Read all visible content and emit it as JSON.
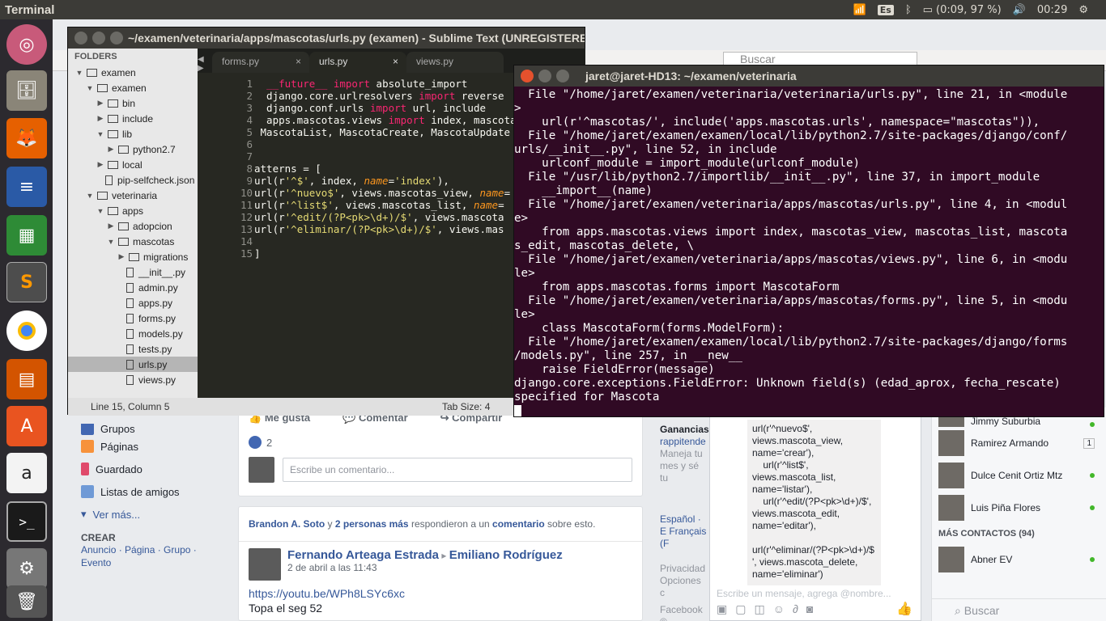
{
  "topbar": {
    "app_name": "Terminal",
    "keyboard": "Es",
    "battery": "(0:09, 97 %)",
    "clock": "00:29"
  },
  "launcher": {
    "items": [
      "dash-home",
      "files",
      "firefox",
      "libreoffice-writer",
      "libreoffice-calc",
      "sublime-text",
      "chrome",
      "libreoffice-impress",
      "software-center",
      "amazon",
      "terminal",
      "system-settings",
      "trash"
    ]
  },
  "browser": {
    "search_placeholder": "Buscar"
  },
  "fb": {
    "leftnav": [
      "Grupos",
      "Páginas",
      "Guardado",
      "Listas de amigos"
    ],
    "see_more": "Ver más...",
    "create_heading": "CREAR",
    "create_links": "Anuncio · Página · Grupo · Evento",
    "actions": [
      "Me gusta",
      "Comentar",
      "Compartir"
    ],
    "like_count": "2",
    "comment_placeholder": "Escribe un comentario...",
    "notice_user": "Brandon A. Soto",
    "notice_mid": " y ",
    "notice_others": "2 personas más",
    "notice_rest": " respondieron a un ",
    "notice_link": "comentario",
    "notice_end": " sobre esto.",
    "post_author": "Fernando Arteaga Estrada",
    "post_target": "Emiliano Rodríguez",
    "post_date": "2 de abril a las 11:43",
    "post_link": "https://youtu.be/WPh8LSYc6xc",
    "post_text": "Topa el seg 52",
    "ad_title": "Ganancias",
    "ad_site": "rappitende",
    "ad_text": "Maneja tu mes y sé tu",
    "languages": "Español · E Français (F",
    "footer1": "Privacidad Opciones c",
    "footer2": "Facebook ©"
  },
  "chat": {
    "message": "url(r'^nuevo$',\nviews.mascota_view,\nname='crear'),\n    url(r'^list$',\nviews.mascota_list,\nname='listar'),\n    url(r'^edit/(?P<pk>\\d+)/$',\nviews.mascota_edit,\nname='editar'),\n\nurl(r'^eliminar/(?P<pk>\\d+)/$\n', views.mascota_delete,\nname='eliminar')",
    "input_placeholder": "Escribe un mensaje, agrega @nombre..."
  },
  "contacts": {
    "top_partial": "Jimmy Suburbia",
    "items": [
      "Ramirez Armando",
      "Dulce Cenit Ortiz Mtz",
      "Luis Piña Flores"
    ],
    "badge": "1",
    "more_heading": "MÁS CONTACTOS (94)",
    "more_items": [
      "Abner EV"
    ],
    "search_placeholder": "Buscar"
  },
  "sublime": {
    "title": "~/examen/veterinaria/apps/mascotas/urls.py (examen) - Sublime Text (UNREGISTERED)",
    "folders_label": "FOLDERS",
    "tree": [
      {
        "label": "examen",
        "type": "folder",
        "indent": 0,
        "open": true
      },
      {
        "label": "examen",
        "type": "folder",
        "indent": 1,
        "open": true
      },
      {
        "label": "bin",
        "type": "folder",
        "indent": 2,
        "open": false
      },
      {
        "label": "include",
        "type": "folder",
        "indent": 2,
        "open": false
      },
      {
        "label": "lib",
        "type": "folder",
        "indent": 2,
        "open": true
      },
      {
        "label": "python2.7",
        "type": "folder",
        "indent": 3,
        "open": false
      },
      {
        "label": "local",
        "type": "folder",
        "indent": 2,
        "open": false
      },
      {
        "label": "pip-selfcheck.json",
        "type": "file",
        "indent": 2
      },
      {
        "label": "veterinaria",
        "type": "folder",
        "indent": 1,
        "open": true
      },
      {
        "label": "apps",
        "type": "folder",
        "indent": 2,
        "open": true
      },
      {
        "label": "adopcion",
        "type": "folder",
        "indent": 3,
        "open": false
      },
      {
        "label": "mascotas",
        "type": "folder",
        "indent": 3,
        "open": true
      },
      {
        "label": "migrations",
        "type": "folder",
        "indent": 4,
        "open": false
      },
      {
        "label": "__init__.py",
        "type": "file",
        "indent": 4
      },
      {
        "label": "admin.py",
        "type": "file",
        "indent": 4
      },
      {
        "label": "apps.py",
        "type": "file",
        "indent": 4
      },
      {
        "label": "forms.py",
        "type": "file",
        "indent": 4
      },
      {
        "label": "models.py",
        "type": "file",
        "indent": 4
      },
      {
        "label": "tests.py",
        "type": "file",
        "indent": 4
      },
      {
        "label": "urls.py",
        "type": "file",
        "indent": 4,
        "selected": true
      },
      {
        "label": "views.py",
        "type": "file",
        "indent": 4
      }
    ],
    "tabs": [
      "forms.py",
      "urls.py",
      "views.py"
    ],
    "active_tab": "urls.py",
    "line_numbers": [
      "1",
      "2",
      "3",
      "4",
      "5",
      "6",
      "7",
      "8",
      "9",
      "10",
      "11",
      "12",
      "13",
      "14",
      "15"
    ],
    "status_position": "Line 15, Column 5",
    "status_tabsize": "Tab Size: 4"
  },
  "terminal": {
    "title": "jaret@jaret-HD13: ~/examen/veterinaria",
    "lines": [
      "  File \"/home/jaret/examen/veterinaria/veterinaria/urls.py\", line 21, in <module",
      ">",
      "    url(r'^mascotas/', include('apps.mascotas.urls', namespace=\"mascotas\")),",
      "  File \"/home/jaret/examen/examen/local/lib/python2.7/site-packages/django/conf/",
      "urls/__init__.py\", line 52, in include",
      "    urlconf_module = import_module(urlconf_module)",
      "  File \"/usr/lib/python2.7/importlib/__init__.py\", line 37, in import_module",
      "    __import__(name)",
      "  File \"/home/jaret/examen/veterinaria/apps/mascotas/urls.py\", line 4, in <modul",
      "e>",
      "    from apps.mascotas.views import index, mascotas_view, mascotas_list, mascota",
      "s_edit, mascotas_delete, \\",
      "  File \"/home/jaret/examen/veterinaria/apps/mascotas/views.py\", line 6, in <modu",
      "le>",
      "    from apps.mascotas.forms import MascotaForm",
      "  File \"/home/jaret/examen/veterinaria/apps/mascotas/forms.py\", line 5, in <modu",
      "le>",
      "    class MascotaForm(forms.ModelForm):",
      "  File \"/home/jaret/examen/examen/local/lib/python2.7/site-packages/django/forms",
      "/models.py\", line 257, in __new__",
      "    raise FieldError(message)",
      "django.core.exceptions.FieldError: Unknown field(s) (edad_aprox, fecha_rescate)",
      "specified for Mascota"
    ]
  },
  "colors": {
    "terminal_bg": "#300a24",
    "editor_bg": "#272822",
    "fb_link": "#365899"
  }
}
